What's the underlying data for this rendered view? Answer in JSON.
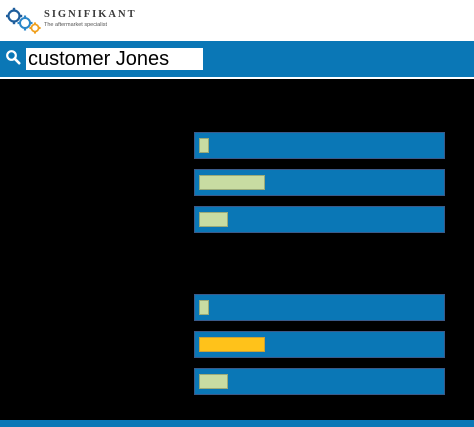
{
  "brand": {
    "name": "SIGNIFIKANT",
    "tagline": "The aftermarket specialist"
  },
  "search": {
    "value": "customer Jones"
  },
  "colors": {
    "bar": "#0a77b6",
    "fill": "#c8dca2",
    "highlight": "#ffc21a",
    "background": "#000000"
  },
  "result_groups": [
    {
      "bars": [
        {
          "level": 0.04,
          "highlighted": false
        },
        {
          "level": 0.27,
          "highlighted": false
        },
        {
          "level": 0.12,
          "highlighted": false
        }
      ]
    },
    {
      "bars": [
        {
          "level": 0.04,
          "highlighted": false
        },
        {
          "level": 0.27,
          "highlighted": true
        },
        {
          "level": 0.12,
          "highlighted": false
        }
      ]
    }
  ]
}
